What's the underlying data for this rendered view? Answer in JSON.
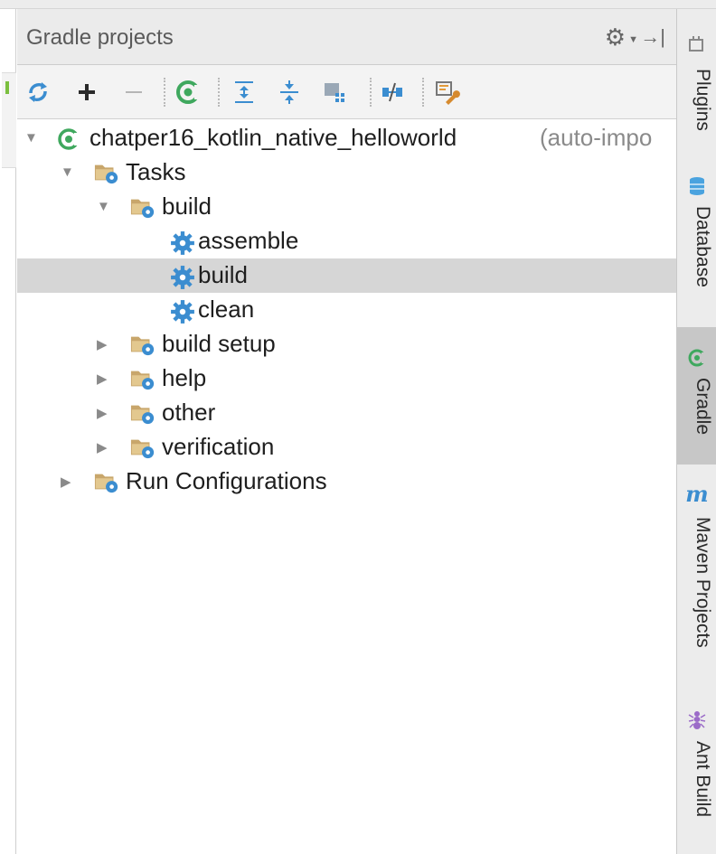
{
  "panel": {
    "title": "Gradle projects"
  },
  "toolbar": {
    "buttons": [
      {
        "name": "refresh-all-projects",
        "icon": "sync-icon"
      },
      {
        "name": "attach-project",
        "icon": "plus-icon"
      },
      {
        "name": "detach-project",
        "icon": "minus-icon"
      },
      {
        "name": "execute-task",
        "icon": "gradle-run-icon"
      },
      {
        "name": "expand-all",
        "icon": "expand-all-icon"
      },
      {
        "name": "collapse-all",
        "icon": "collapse-all-icon"
      },
      {
        "name": "group-modules",
        "icon": "group-modules-icon"
      },
      {
        "name": "toggle-offline-mode",
        "icon": "offline-icon"
      },
      {
        "name": "gradle-settings",
        "icon": "settings-wrench-icon"
      }
    ]
  },
  "tree": {
    "project": {
      "label": "chatper16_kotlin_native_helloworld",
      "hint": "(auto-impo"
    },
    "tasks_label": "Tasks",
    "groups": {
      "build": {
        "label": "build",
        "tasks": [
          "assemble",
          "build",
          "clean"
        ],
        "selected_task": "build"
      },
      "build_setup": "build setup",
      "help": "help",
      "other": "other",
      "verification": "verification"
    },
    "run_configurations": "Run Configurations"
  },
  "right_tool_windows": [
    {
      "label": "Plugins",
      "icon": "plugins-icon",
      "active": false
    },
    {
      "label": "Database",
      "icon": "database-icon",
      "active": false
    },
    {
      "label": "Gradle",
      "icon": "gradle-icon",
      "active": true
    },
    {
      "label": "Maven Projects",
      "icon": "maven-icon",
      "active": false
    },
    {
      "label": "Ant Build",
      "icon": "ant-icon",
      "active": false
    }
  ],
  "colors": {
    "selection": "#d6d6d6",
    "active_tab": "#c7c7c7",
    "gradle_green": "#3fa85e",
    "gear_blue": "#3b8dd0",
    "folder_tan": "#c8a66b"
  }
}
